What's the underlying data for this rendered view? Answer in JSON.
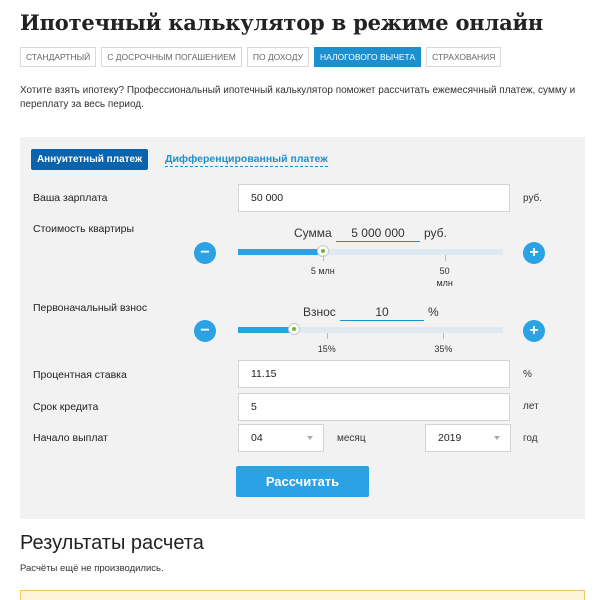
{
  "header": {
    "title": "Ипотечный калькулятор в режиме онлайн"
  },
  "tabs": [
    {
      "label": "СТАНДАРТНЫЙ",
      "active": false
    },
    {
      "label": "С ДОСРОЧНЫМ ПОГАШЕНИЕМ",
      "active": false
    },
    {
      "label": "ПО ДОХОДУ",
      "active": false
    },
    {
      "label": "НАЛОГОВОГО ВЫЧЕТА",
      "active": true
    },
    {
      "label": "СТРАХОВАНИЯ",
      "active": false
    }
  ],
  "intro": "Хотите взять ипотеку? Профессиональный ипотечный калькулятор поможет рассчитать ежемесячный платеж, сумму и переплату за весь период.",
  "payment_mode": {
    "annuity_label": "Аннуитетный платеж",
    "differentiated_label": "Дифференцированный платеж"
  },
  "salary": {
    "label": "Ваша зарплата",
    "value": "50 000",
    "unit": "руб."
  },
  "property_cost": {
    "label": "Стоимость квартиры",
    "caption": "Сумма",
    "value": "5 000 000",
    "unit": "руб.",
    "slider_level": 0.32,
    "minus": "−",
    "plus": "+",
    "ticks": [
      {
        "label": "5 млн",
        "at": 0.32
      },
      {
        "label": "50 млн",
        "at": 0.78
      }
    ]
  },
  "down_payment": {
    "label": "Первоначальный взнос",
    "caption": "Взнос",
    "value": "10",
    "unit": "%",
    "slider_level": 0.21,
    "minus": "−",
    "plus": "+",
    "ticks": [
      {
        "label": "15%",
        "at": 0.335
      },
      {
        "label": "35%",
        "at": 0.775
      }
    ]
  },
  "rate": {
    "label": "Процентная ставка",
    "value": "11.15",
    "unit": "%"
  },
  "term": {
    "label": "Срок кредита",
    "value": "5",
    "unit": "лет"
  },
  "start": {
    "label": "Начало выплат",
    "month_value": "04",
    "month_unit": "месяц",
    "year_value": "2019",
    "year_unit": "год"
  },
  "calculate_label": "Рассчитать",
  "results": {
    "title": "Результаты расчета",
    "note": "Расчёты ещё не производились."
  },
  "colors": {
    "accent": "#2aa2e3",
    "active_tab": "#1c8fd0",
    "mode_button": "#0a64ad",
    "knob_dot": "#6cbc2f"
  }
}
